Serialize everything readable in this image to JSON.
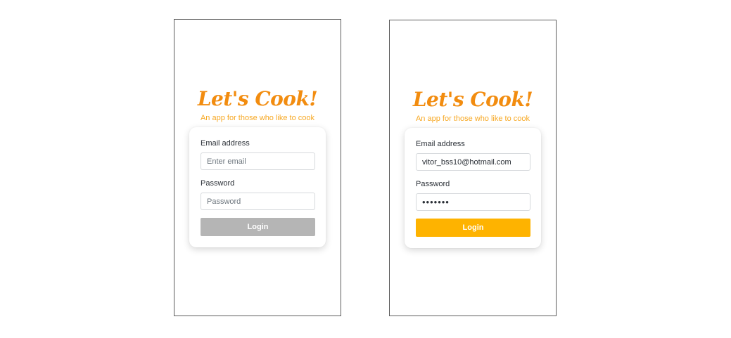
{
  "app": {
    "title": "Let's Cook!",
    "subtitle": "An app for those who like to cook"
  },
  "screens": [
    {
      "state": "empty",
      "email_label": "Email address",
      "email_value": "",
      "email_placeholder": "Enter email",
      "password_label": "Password",
      "password_value": "",
      "password_placeholder": "Password",
      "login_label": "Login",
      "login_enabled": false
    },
    {
      "state": "filled",
      "email_label": "Email address",
      "email_value": "vitor_bss10@hotmail.com",
      "email_placeholder": "Enter email",
      "password_label": "Password",
      "password_value": "•••••••",
      "password_placeholder": "Password",
      "login_label": "Login",
      "login_enabled": true
    }
  ],
  "colors": {
    "title": "#f28c0f",
    "subtitle": "#f7a823",
    "login_disabled": "#b5b5b5",
    "login_active": "#feb300"
  }
}
